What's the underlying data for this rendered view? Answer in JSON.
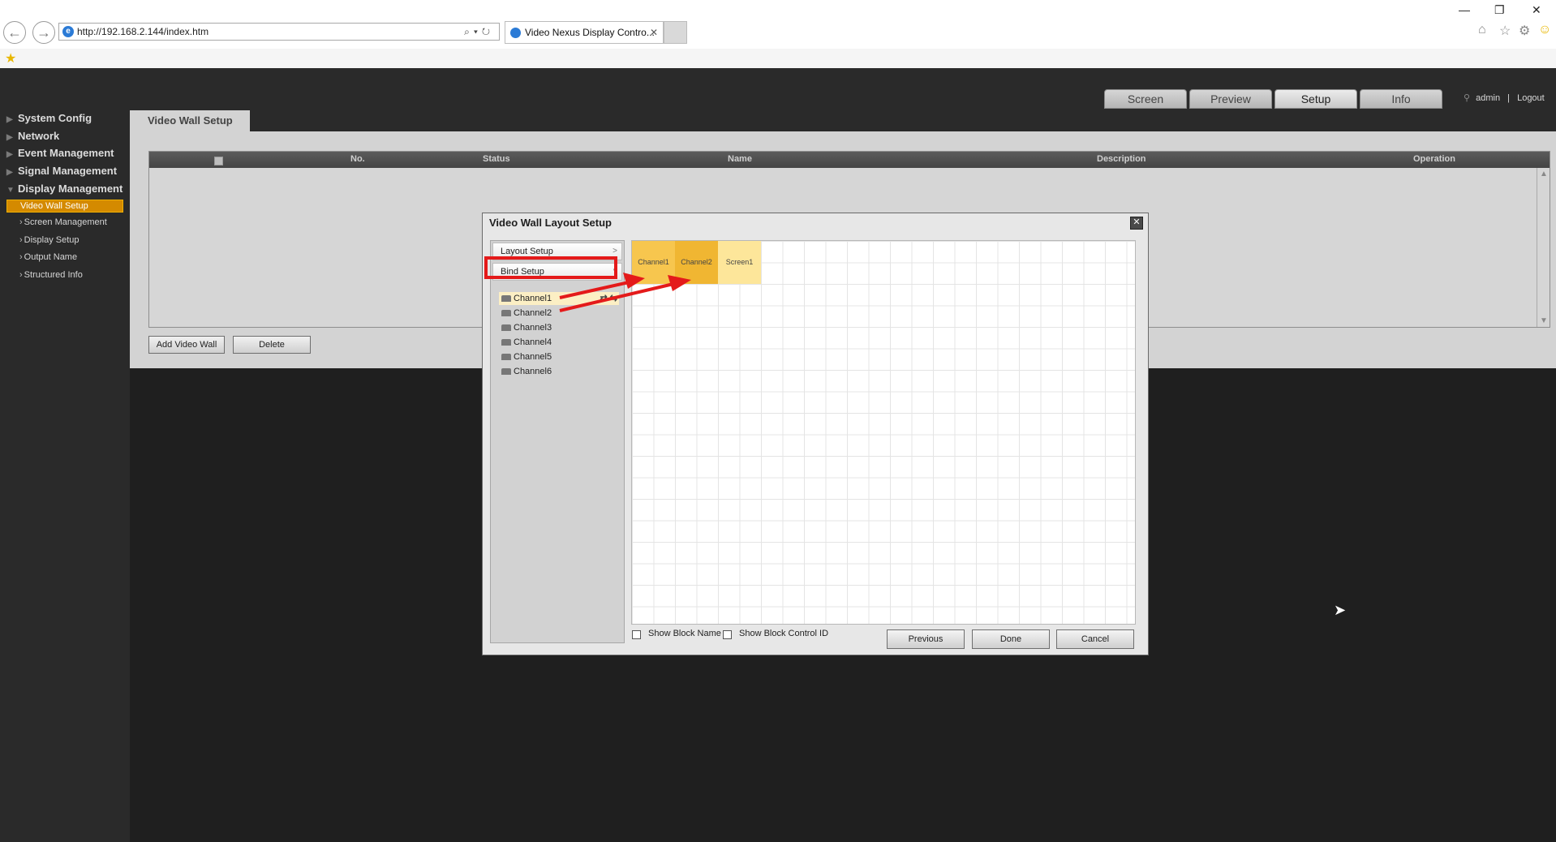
{
  "browser": {
    "url": "http://192.168.2.144/index.htm",
    "tab_title": "Video Nexus Display Contro...",
    "tab_close": "✕"
  },
  "app": {
    "main_tabs": [
      {
        "label": "Screen"
      },
      {
        "label": "Preview"
      },
      {
        "label": "Setup"
      },
      {
        "label": "Info"
      }
    ],
    "user": "admin",
    "separator": "|",
    "logout": "Logout"
  },
  "sidebar": {
    "top": [
      {
        "label": "System Config"
      },
      {
        "label": "Network"
      },
      {
        "label": "Event Management"
      },
      {
        "label": "Signal Management"
      },
      {
        "label": "Display Management"
      }
    ],
    "sub": [
      {
        "label": "Video Wall Setup"
      },
      {
        "label": "Screen Management"
      },
      {
        "label": "Display Setup"
      },
      {
        "label": "Output Name"
      },
      {
        "label": "Structured Info"
      }
    ]
  },
  "main": {
    "section_title": "Video Wall Setup",
    "columns": [
      "No.",
      "Status",
      "Name",
      "Description",
      "Operation"
    ],
    "add_button": "Add Video Wall",
    "delete_button": "Delete"
  },
  "modal": {
    "title": "Video Wall Layout Setup",
    "close": "✕",
    "layout_setup": "Layout Setup",
    "bind_setup": "Bind Setup",
    "channels": [
      "Channel1",
      "Channel2",
      "Channel3",
      "Channel4",
      "Channel5",
      "Channel6"
    ],
    "blocks": [
      "Channel1",
      "Channel2",
      "Screen1"
    ],
    "show_block_name": "Show Block Name",
    "show_block_control_id": "Show Block Control ID",
    "previous": "Previous",
    "done": "Done",
    "cancel": "Cancel"
  },
  "colors": {
    "selected_nav": "#d48a00",
    "annotation_red": "#e41a1a",
    "block_channel1": "#f7c64e",
    "block_channel2": "#f0b632",
    "block_screen1": "#fde69a"
  }
}
